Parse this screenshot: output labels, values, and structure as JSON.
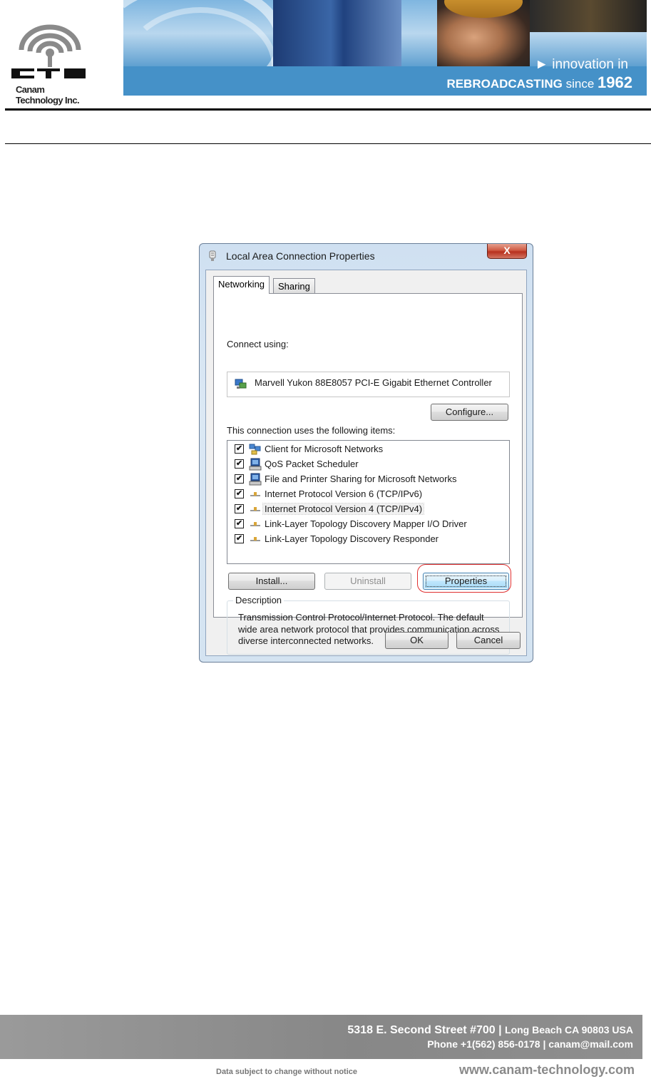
{
  "header": {
    "company_name": "Canam Technology Inc.",
    "logo_text": "CTI",
    "tagline_1": "► innovation in",
    "tagline_2_bold": "REBROADCASTING",
    "tagline_2_since": "since",
    "tagline_2_year": "1962"
  },
  "dialog": {
    "title": "Local Area Connection Properties",
    "close_label": "X",
    "tabs": [
      "Networking",
      "Sharing"
    ],
    "connect_using_label": "Connect using:",
    "adapter_name": "Marvell Yukon 88E8057 PCI-E Gigabit Ethernet Controller",
    "configure_label": "Configure...",
    "items_label": "This connection uses the following items:",
    "items": [
      {
        "label": "Client for Microsoft Networks",
        "checked": true,
        "icon": "network-client-icon"
      },
      {
        "label": "QoS Packet Scheduler",
        "checked": true,
        "icon": "network-service-icon"
      },
      {
        "label": "File and Printer Sharing for Microsoft Networks",
        "checked": true,
        "icon": "network-service-icon"
      },
      {
        "label": "Internet Protocol Version 6 (TCP/IPv6)",
        "checked": true,
        "icon": "protocol-icon"
      },
      {
        "label": "Internet Protocol Version 4 (TCP/IPv4)",
        "checked": true,
        "icon": "protocol-icon",
        "selected": true
      },
      {
        "label": "Link-Layer Topology Discovery Mapper I/O Driver",
        "checked": true,
        "icon": "protocol-icon"
      },
      {
        "label": "Link-Layer Topology Discovery Responder",
        "checked": true,
        "icon": "protocol-icon"
      }
    ],
    "check_mark": "✔",
    "install_label": "Install...",
    "uninstall_label": "Uninstall",
    "properties_label": "Properties",
    "description_legend": "Description",
    "description_text": "Transmission Control Protocol/Internet Protocol. The default wide area network protocol that provides communication across diverse interconnected networks.",
    "ok_label": "OK",
    "cancel_label": "Cancel"
  },
  "footer": {
    "address": "5318 E. Second Street  #700",
    "city": "Long Beach CA 90803 USA",
    "phone": "Phone +1(562) 856-0178",
    "email": "canam@mail.com",
    "notice": "Data subject to change without notice",
    "website": "www.canam-technology.com"
  },
  "colors": {
    "banner_blue": "#4591c8",
    "footer_gray": "#8c8c8c",
    "highlight_red": "#e03030"
  }
}
